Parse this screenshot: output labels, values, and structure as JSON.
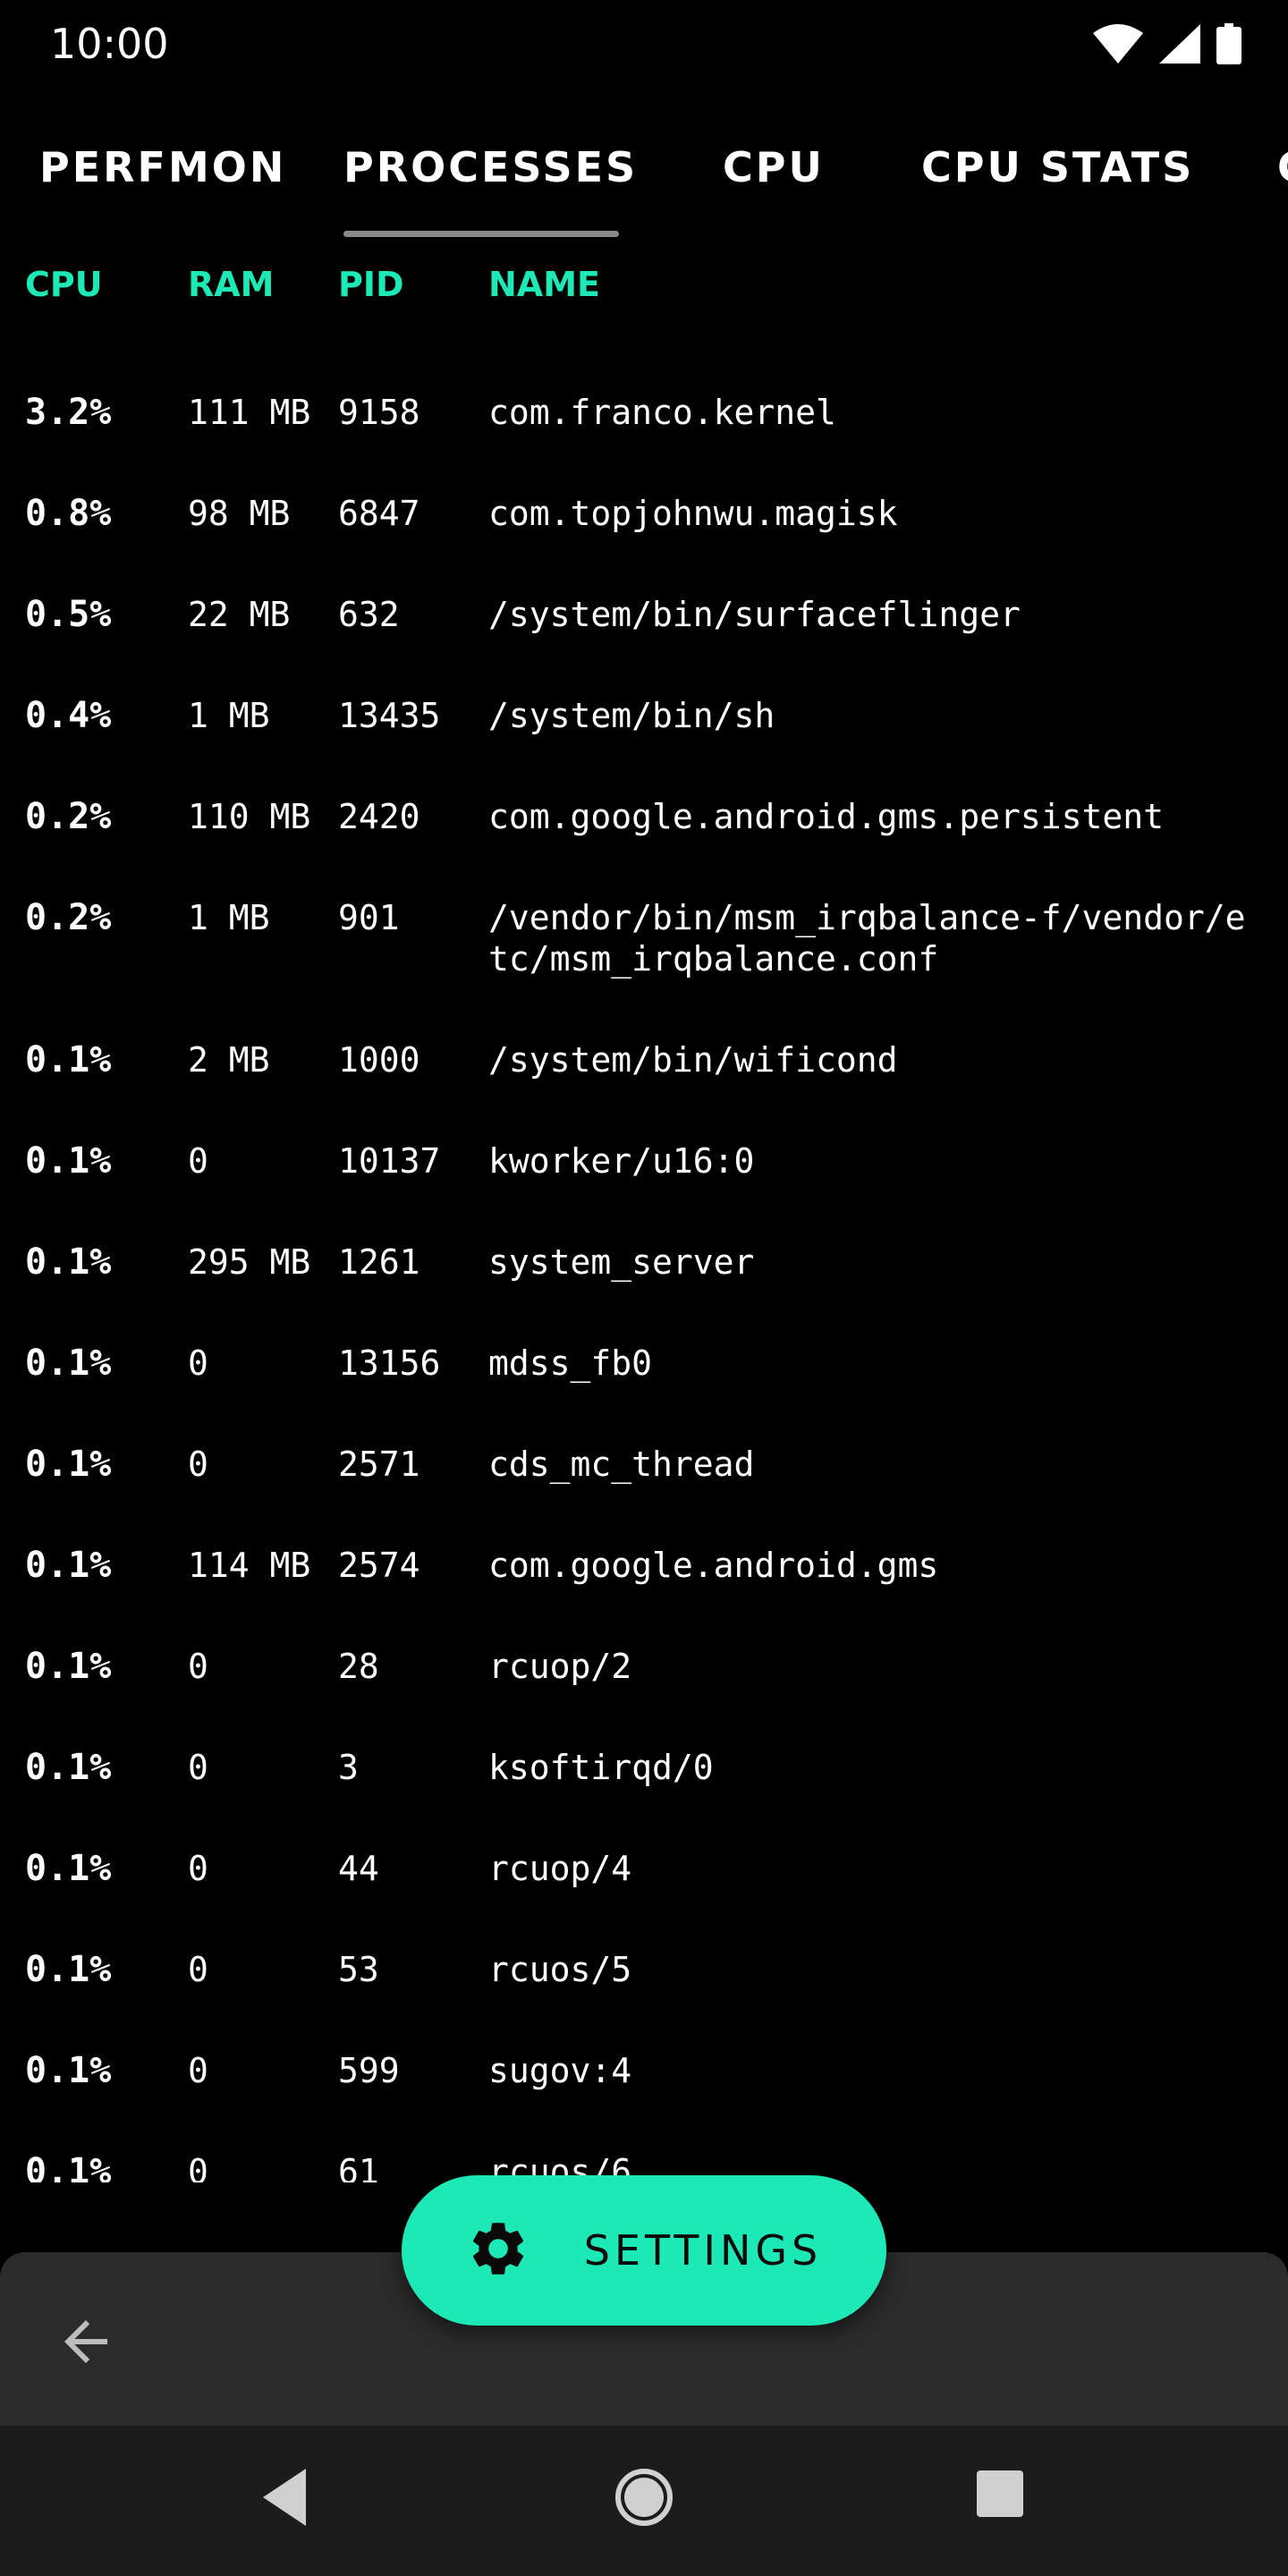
{
  "status_bar": {
    "time": "10:00"
  },
  "tabs": [
    {
      "label": "PERFMON",
      "active": false
    },
    {
      "label": "PROCESSES",
      "active": true
    },
    {
      "label": "CPU",
      "active": false
    },
    {
      "label": "CPU STATS",
      "active": false
    }
  ],
  "table": {
    "headers": {
      "cpu": "CPU",
      "ram": "RAM",
      "pid": "PID",
      "name": "NAME"
    },
    "rows": [
      {
        "cpu": "3.2%",
        "ram": "111 MB",
        "pid": "9158",
        "name": "com.franco.kernel"
      },
      {
        "cpu": "0.8%",
        "ram": "98 MB",
        "pid": "6847",
        "name": "com.topjohnwu.magisk"
      },
      {
        "cpu": "0.5%",
        "ram": "22 MB",
        "pid": "632",
        "name": "/system/bin/surfaceflinger"
      },
      {
        "cpu": "0.4%",
        "ram": "1 MB",
        "pid": "13435",
        "name": "/system/bin/sh"
      },
      {
        "cpu": "0.2%",
        "ram": "110 MB",
        "pid": "2420",
        "name": "com.google.android.gms.persistent"
      },
      {
        "cpu": "0.2%",
        "ram": "1 MB",
        "pid": "901",
        "name": "/vendor/bin/msm_irqbalance-f/vendor/etc/msm_irqbalance.conf"
      },
      {
        "cpu": "0.1%",
        "ram": "2 MB",
        "pid": "1000",
        "name": "/system/bin/wificond"
      },
      {
        "cpu": "0.1%",
        "ram": "0",
        "pid": "10137",
        "name": "kworker/u16:0"
      },
      {
        "cpu": "0.1%",
        "ram": "295 MB",
        "pid": "1261",
        "name": "system_server"
      },
      {
        "cpu": "0.1%",
        "ram": "0",
        "pid": "13156",
        "name": "mdss_fb0"
      },
      {
        "cpu": "0.1%",
        "ram": "0",
        "pid": "2571",
        "name": "cds_mc_thread"
      },
      {
        "cpu": "0.1%",
        "ram": "114 MB",
        "pid": "2574",
        "name": "com.google.android.gms"
      },
      {
        "cpu": "0.1%",
        "ram": "0",
        "pid": "28",
        "name": "rcuop/2"
      },
      {
        "cpu": "0.1%",
        "ram": "0",
        "pid": "3",
        "name": "ksoftirqd/0"
      },
      {
        "cpu": "0.1%",
        "ram": "0",
        "pid": "44",
        "name": "rcuop/4"
      },
      {
        "cpu": "0.1%",
        "ram": "0",
        "pid": "53",
        "name": "rcuos/5"
      },
      {
        "cpu": "0.1%",
        "ram": "0",
        "pid": "599",
        "name": "sugov:4"
      },
      {
        "cpu": "0.1%",
        "ram": "0",
        "pid": "61",
        "name": "rcuos/6"
      }
    ]
  },
  "fab": {
    "label": "SETTINGS",
    "icon": "gear-icon"
  },
  "bottom_bar": {
    "back_icon": "arrow-left-icon"
  },
  "nav_bar": {
    "back": "nav-back-icon",
    "home": "nav-home-icon",
    "recents": "nav-recents-icon"
  },
  "colors": {
    "accent": "#1de9b6",
    "background": "#000000",
    "bottom_bar": "#2b2b2b",
    "nav_bar": "#1c1c1c"
  }
}
